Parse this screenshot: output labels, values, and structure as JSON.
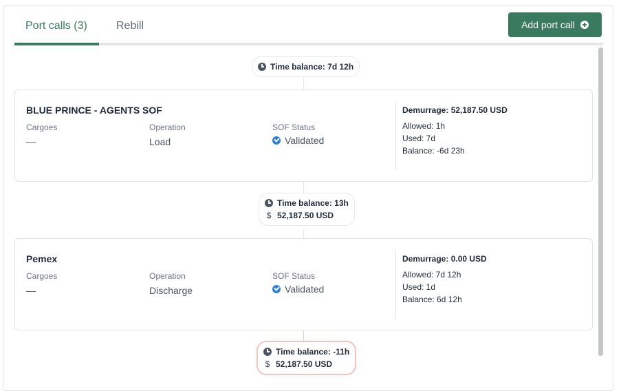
{
  "tabs": [
    {
      "label": "Port calls (3)"
    },
    {
      "label": "Rebill"
    }
  ],
  "actions": {
    "add_port_call": "Add port call"
  },
  "balances": [
    {
      "time": "Time balance: 7d 12h"
    },
    {
      "time": "Time balance: 13h",
      "amount": "52,187.50 USD"
    },
    {
      "time": "Time balance: -11h",
      "amount": "52,187.50 USD"
    }
  ],
  "port_calls": [
    {
      "title": "BLUE PRINCE - AGENTS SOF",
      "labels": {
        "cargoes": "Cargoes",
        "operation": "Operation",
        "sof_status": "SOF Status"
      },
      "cargoes": "—",
      "operation": "Load",
      "sof_status": "Validated",
      "demurrage": "Demurrage: 52,187.50 USD",
      "allowed": "Allowed: 1h",
      "used": "Used: 7d",
      "balance": "Balance: -6d 23h"
    },
    {
      "title": "Pemex",
      "labels": {
        "cargoes": "Cargoes",
        "operation": "Operation",
        "sof_status": "SOF Status"
      },
      "cargoes": "—",
      "operation": "Discharge",
      "sof_status": "Validated",
      "demurrage": "Demurrage: 0.00 USD",
      "allowed": "Allowed: 7d 12h",
      "used": "Used: 1d",
      "balance": "Balance: 6d 12h"
    }
  ],
  "colors": {
    "accent": "#3a7a5f",
    "validated": "#2f7fd6",
    "negative_border": "#f2c2bc"
  },
  "icons": {
    "add": "plus-circle-icon",
    "time": "clock-icon",
    "money": "dollar-icon",
    "status": "check-badge-icon"
  }
}
